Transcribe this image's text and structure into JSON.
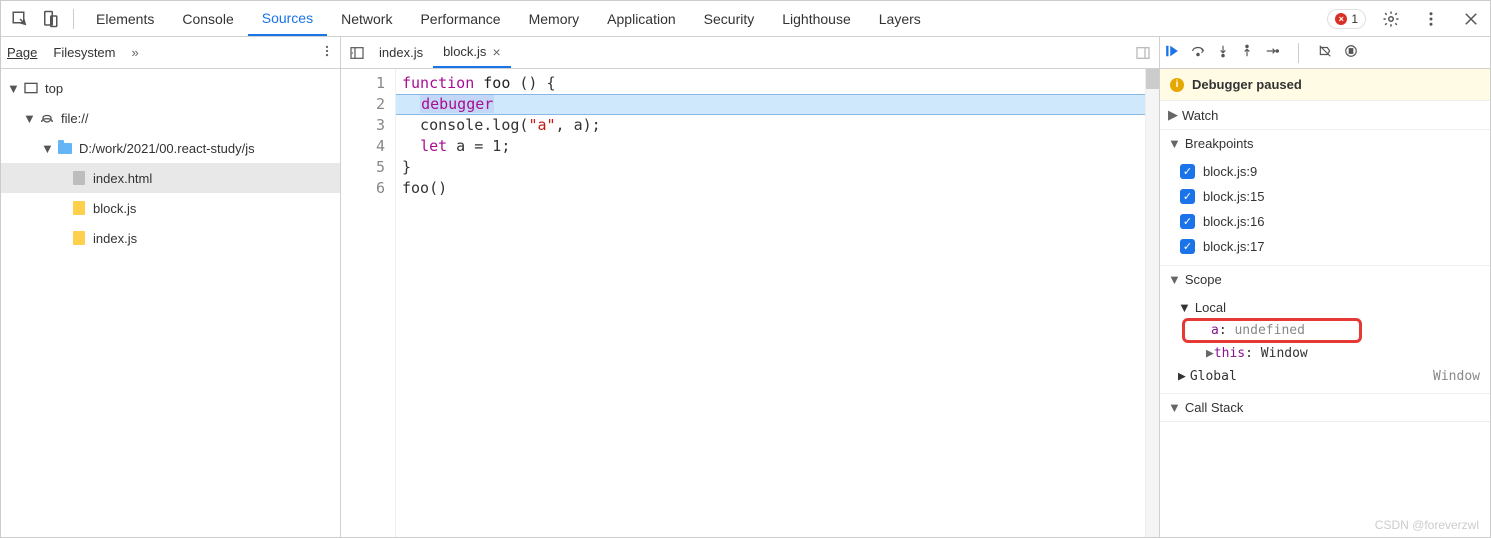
{
  "toolbar": {
    "tabs": [
      "Elements",
      "Console",
      "Sources",
      "Network",
      "Performance",
      "Memory",
      "Application",
      "Security",
      "Lighthouse",
      "Layers"
    ],
    "active": "Sources",
    "error_count": "1"
  },
  "navigator": {
    "tabs": {
      "page": "Page",
      "fs": "Filesystem"
    },
    "tree": {
      "top": "top",
      "origin": "file://",
      "folder": "D:/work/2021/00.react-study/js",
      "files": [
        "index.html",
        "block.js",
        "index.js"
      ]
    }
  },
  "editor": {
    "open_tabs": [
      {
        "name": "index.js",
        "active": false
      },
      {
        "name": "block.js",
        "active": true
      }
    ],
    "lines": [
      {
        "n": "1",
        "tokens": [
          {
            "t": "function ",
            "c": "kw"
          },
          {
            "t": "foo ",
            "c": "fn"
          },
          {
            "t": "() {",
            "c": ""
          }
        ]
      },
      {
        "n": "2",
        "tokens": [
          {
            "t": "  ",
            "c": ""
          },
          {
            "t": "debugger",
            "c": "kw dbg"
          }
        ]
      },
      {
        "n": "3",
        "tokens": [
          {
            "t": "  console.log(",
            "c": ""
          },
          {
            "t": "\"a\"",
            "c": "str"
          },
          {
            "t": ", a);",
            "c": ""
          }
        ]
      },
      {
        "n": "4",
        "tokens": [
          {
            "t": "  ",
            "c": ""
          },
          {
            "t": "let",
            "c": "kw"
          },
          {
            "t": " a = 1;",
            "c": ""
          }
        ]
      },
      {
        "n": "5",
        "tokens": [
          {
            "t": "}",
            "c": ""
          }
        ]
      },
      {
        "n": "6",
        "tokens": [
          {
            "t": "foo()",
            "c": ""
          }
        ]
      }
    ],
    "highlighted_line": 2
  },
  "debugger": {
    "status": "Debugger paused",
    "watch": "Watch",
    "breakpoints": {
      "label": "Breakpoints",
      "items": [
        "block.js:9",
        "block.js:15",
        "block.js:16",
        "block.js:17"
      ]
    },
    "scope": {
      "label": "Scope",
      "local": {
        "label": "Local",
        "a_name": "a",
        "a_val": "undefined",
        "this_name": "this",
        "this_val": "Window"
      },
      "global": {
        "label": "Global",
        "val": "Window"
      }
    },
    "callstack": "Call Stack"
  },
  "watermark": "CSDN @foreverzwl"
}
